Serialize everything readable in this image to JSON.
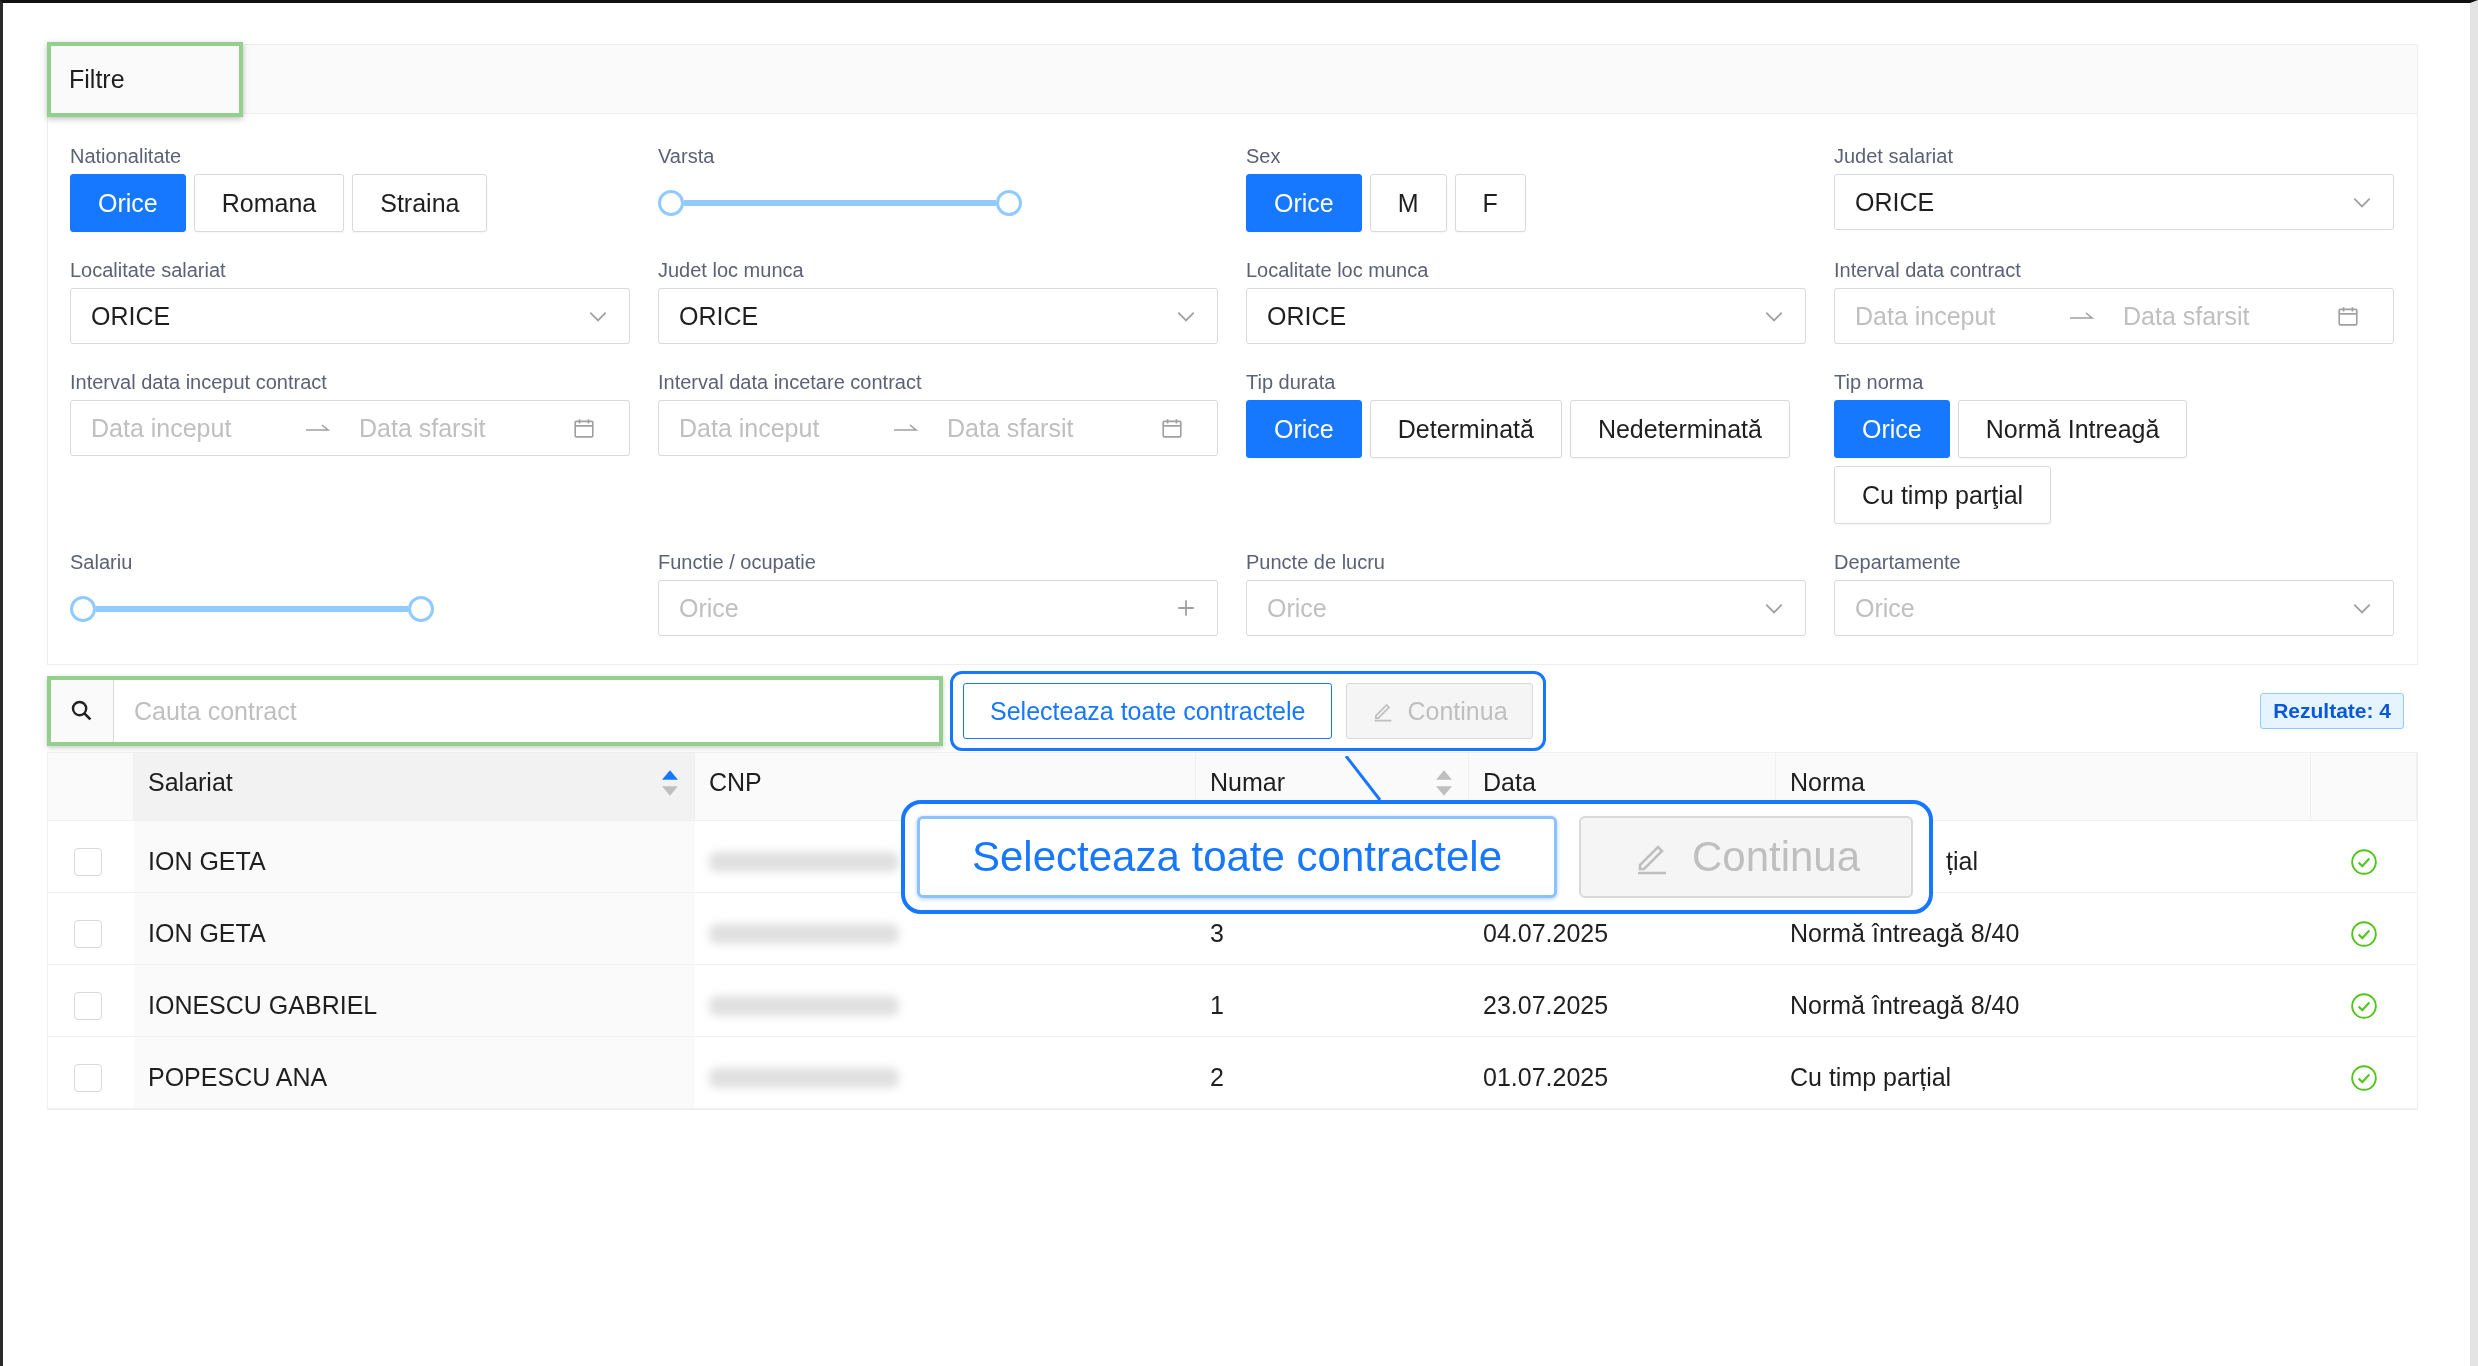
{
  "filter_panel": {
    "title": "Filtre",
    "filters": [
      {
        "kind": "buttons",
        "label": "Nationalitate",
        "options": [
          {
            "label": "Orice",
            "selected": true
          },
          {
            "label": "Romana",
            "selected": false
          },
          {
            "label": "Straina",
            "selected": false
          }
        ]
      },
      {
        "kind": "range",
        "label": "Varsta",
        "level": 1
      },
      {
        "kind": "buttons",
        "label": "Sex",
        "options": [
          {
            "label": "Orice",
            "selected": true
          },
          {
            "label": "M",
            "selected": false
          },
          {
            "label": "F",
            "selected": false
          }
        ]
      },
      {
        "kind": "select",
        "label": "Judet salariat",
        "value": "ORICE"
      },
      {
        "kind": "select",
        "label": "Localitate salariat",
        "value": "ORICE"
      },
      {
        "kind": "select",
        "label": "Judet loc munca",
        "value": "ORICE"
      },
      {
        "kind": "select",
        "label": "Localitate loc munca",
        "value": "ORICE"
      },
      {
        "kind": "daterange",
        "label": "Interval data contract",
        "start_placeholder": "Data inceput",
        "end_placeholder": "Data sfarsit"
      },
      {
        "kind": "daterange",
        "label": "Interval data inceput contract",
        "start_placeholder": "Data inceput",
        "end_placeholder": "Data sfarsit"
      },
      {
        "kind": "daterange",
        "label": "Interval data incetare contract",
        "start_placeholder": "Data inceput",
        "end_placeholder": "Data sfarsit"
      },
      {
        "kind": "buttons",
        "label": "Tip durata",
        "options": [
          {
            "label": "Orice",
            "selected": true
          },
          {
            "label": "Determinată",
            "selected": false
          },
          {
            "label": "Nedeterminată",
            "selected": false
          }
        ]
      },
      {
        "kind": "buttons",
        "label": "Tip norma",
        "options": [
          {
            "label": "Orice",
            "selected": true
          },
          {
            "label": "Normă Intreagă",
            "selected": false
          },
          {
            "label": "Cu timp parţial",
            "selected": false
          }
        ]
      },
      {
        "kind": "range",
        "label": "Salariu",
        "level": 1
      },
      {
        "kind": "tags",
        "label": "Functie / ocupatie",
        "placeholder": "Orice"
      },
      {
        "kind": "select",
        "label": "Puncte de lucru",
        "placeholder": "Orice"
      },
      {
        "kind": "select",
        "label": "Departamente",
        "placeholder": "Orice"
      }
    ]
  },
  "toolbar": {
    "search": {
      "placeholder": "Cauta contract"
    },
    "select_all": "Selecteaza toate contractele",
    "continue": {
      "label": "Continua",
      "disabled": true
    },
    "results": "Rezultate: 4"
  },
  "table": {
    "columns": [
      {
        "label": "Salariat",
        "kind": "sortable",
        "sorted": true
      },
      {
        "label": "CNP",
        "kind": "plain"
      },
      {
        "label": "Numar",
        "kind": "sortable",
        "sorted": false
      },
      {
        "label": "Data",
        "kind": "plain"
      },
      {
        "label": "Norma",
        "kind": "plain"
      }
    ],
    "rows": [
      {
        "checked": false,
        "salariat": "ION GETA",
        "norma": "țial",
        "norma_cut": true,
        "valid": true
      },
      {
        "checked": false,
        "salariat": "ION GETA",
        "numar": "3",
        "data": "04.07.2025",
        "norma": "Normă întreagă 8/40",
        "valid": true
      },
      {
        "checked": false,
        "salariat": "IONESCU GABRIEL",
        "numar": "1",
        "data": "23.07.2025",
        "norma": "Normă întreagă 8/40",
        "valid": true
      },
      {
        "checked": false,
        "salariat": "POPESCU ANA",
        "numar": "2",
        "data": "01.07.2025",
        "norma": "Cu timp parțial",
        "valid": true
      }
    ]
  },
  "callout": {
    "select_all": "Selecteaza toate contractele",
    "continue": {
      "label": "Continua",
      "disabled": true
    }
  }
}
